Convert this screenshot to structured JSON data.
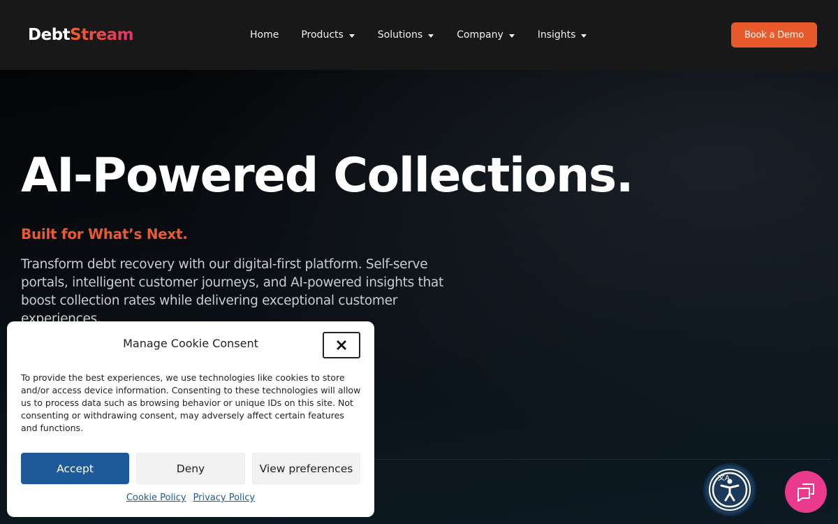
{
  "header": {
    "logo": {
      "part1": "Debt",
      "part2": "Stream"
    },
    "nav": [
      {
        "label": "Home",
        "dropdown": false
      },
      {
        "label": "Products",
        "dropdown": true
      },
      {
        "label": "Solutions",
        "dropdown": true
      },
      {
        "label": "Company",
        "dropdown": true
      },
      {
        "label": "Insights",
        "dropdown": true
      }
    ],
    "cta_label": "Book a Demo"
  },
  "hero": {
    "title_part1": "AI-Powered ",
    "title_highlight": "Collections.",
    "subtitle": "Built for What’s Next.",
    "description": "Transform debt recovery with our digital-first platform. Self-serve portals, intelligent customer journeys, and AI-powered insights that boost collection rates while delivering exceptional customer experiences."
  },
  "cookie": {
    "title": "Manage Cookie Consent",
    "text": "To provide the best experiences, we use technologies like cookies to store and/or access device information. Consenting to these technologies will allow us to process data such as browsing behavior or unique IDs on this site. Not consenting or withdrawing consent, may adversely affect certain features and functions.",
    "accept_label": "Accept",
    "deny_label": "Deny",
    "prefs_label": "View preferences",
    "cookie_policy_label": "Cookie Policy",
    "privacy_policy_label": "Privacy Policy"
  },
  "icons": {
    "close": "close-icon",
    "caret": "chevron-down-icon",
    "accessibility": "accessibility-icon",
    "chat": "chat-icon"
  },
  "colors": {
    "brand_orange": "#e8592b",
    "brand_pink": "#e0346a",
    "accept_blue": "#1e5a9a",
    "chat_pink": "#ea3a8e",
    "header_bg": "#181818"
  }
}
